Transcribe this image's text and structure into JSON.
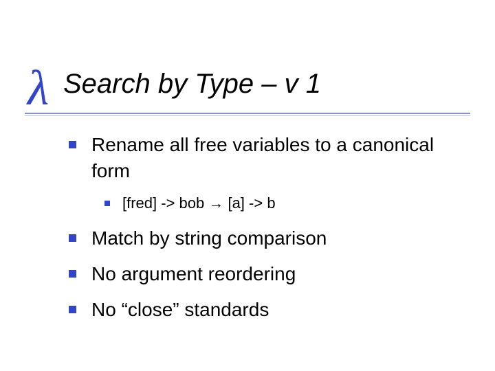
{
  "title": "Search by Type – v 1",
  "bullets": [
    {
      "text": "Rename all free variables to a canonical form",
      "sub": [
        "[fred] -> bob   →   [a] -> b"
      ]
    },
    {
      "text": "Match by string comparison"
    },
    {
      "text": "No argument reordering"
    },
    {
      "text": "No “close” standards"
    }
  ]
}
